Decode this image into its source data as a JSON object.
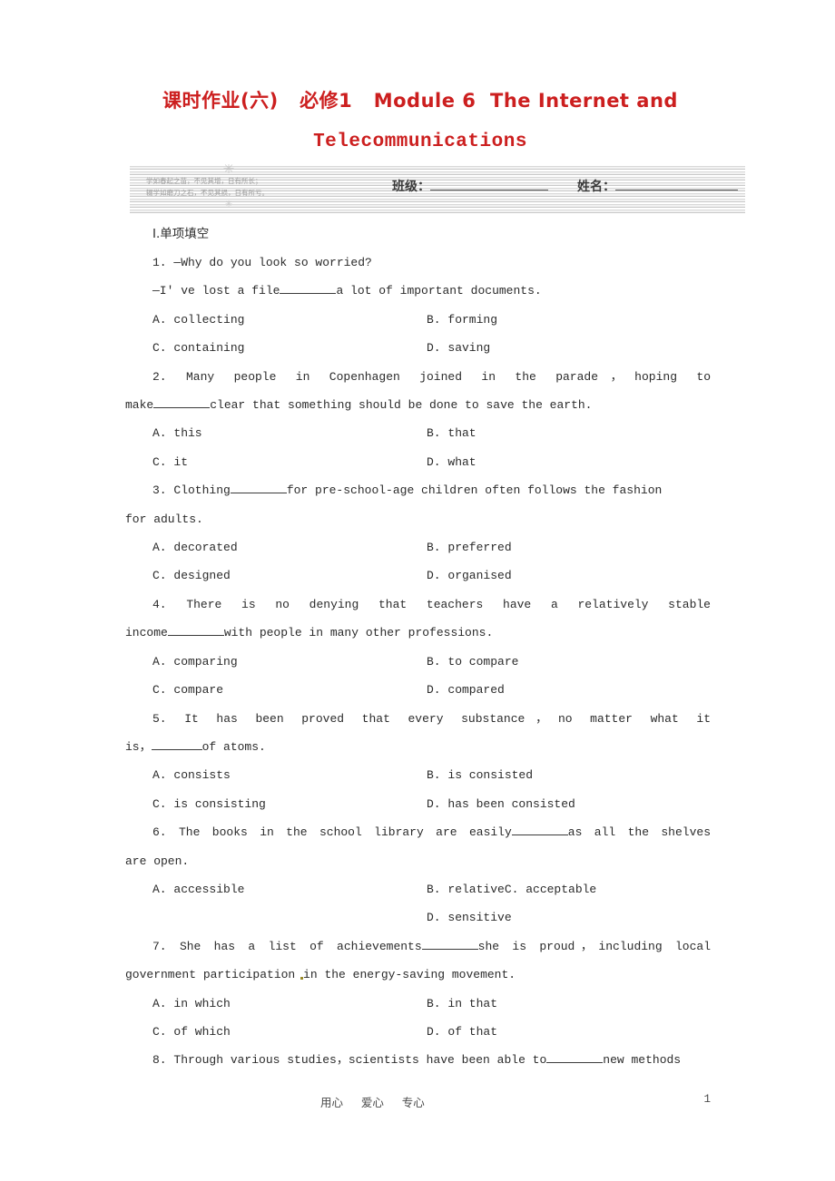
{
  "title": {
    "line1": "课时作业(六)   必修1   Module 6  The Internet and",
    "line2": "Telecommunications"
  },
  "header_box": {
    "proverb_line1": "学如春起之苗，不见其增，日有所长；",
    "proverb_line2": "辍学如磨刀之石，不见其损，日有所亏。",
    "flower_top": "✳",
    "flower_bottom": "✳",
    "class_label": "班级：",
    "class_value": "",
    "name_label": "姓名：",
    "name_value": ""
  },
  "section": {
    "heading": "Ⅰ.单项填空"
  },
  "questions": [
    {
      "number": "1.",
      "stem_line1": "1. —Why do you look so worried?",
      "stem_line2_pre": "—I' ve lost a file",
      "stem_line2_post": "a lot of important documents.",
      "options": {
        "a": "A. collecting",
        "b": "B. forming",
        "c": "C. containing",
        "d": "D. saving"
      }
    },
    {
      "number": "2.",
      "stem_line1": "2. Many people in Copenhagen joined in the parade，hoping to",
      "stem_line2_pre": "make",
      "stem_line2_post": "clear that something should be done to save the earth.",
      "options": {
        "a": "A. this",
        "b": "B. that",
        "c": "C. it",
        "d": "D. what"
      }
    },
    {
      "number": "3.",
      "stem_line1_pre": "3. Clothing",
      "stem_line1_post": "for pre-school-age children often follows the fashion",
      "stem_line2": "for adults.",
      "options": {
        "a": "A. decorated",
        "b": "B. preferred",
        "c": "C. designed",
        "d": "D. organised"
      }
    },
    {
      "number": "4.",
      "stem_line1": "4. There is no denying that teachers have a relatively stable",
      "stem_line2_pre": "income",
      "stem_line2_post": "with people in many other professions.",
      "options": {
        "a": "A. comparing",
        "b": "B. to compare",
        "c": "C. compare",
        "d": "D. compared"
      }
    },
    {
      "number": "5.",
      "stem_line1": "5. It has been proved that every substance，no matter what it",
      "stem_line2_pre": "is，",
      "stem_line2_post": "of atoms.",
      "options": {
        "a": "A. consists",
        "b": "B. is consisted",
        "c": "C. is consisting",
        "d": "D. has been consisted"
      }
    },
    {
      "number": "6.",
      "stem_line1_pre": "6. The books in the school library are easily",
      "stem_line1_post": "as all the shelves",
      "stem_line2": "are open.",
      "options": {
        "a": "A. accessible",
        "b": "B. relativeC. acceptable",
        "c": "",
        "d": "D. sensitive"
      }
    },
    {
      "number": "7.",
      "stem_line1_pre": "7. She has a list of achievements",
      "stem_line1_post": "she is proud，including local",
      "stem_line2_pre": "government participation ",
      "stem_line2_post": "in the energy-saving movement.",
      "options": {
        "a": "A. in which",
        "b": "B. in that",
        "c": "C. of which",
        "d": "D. of that"
      }
    },
    {
      "number": "8.",
      "stem_line1_pre": "8. Through various studies，scientists have been able to",
      "stem_line1_post": "new methods"
    }
  ],
  "footer": {
    "center": "用心     爱心     专心",
    "page": "1"
  }
}
